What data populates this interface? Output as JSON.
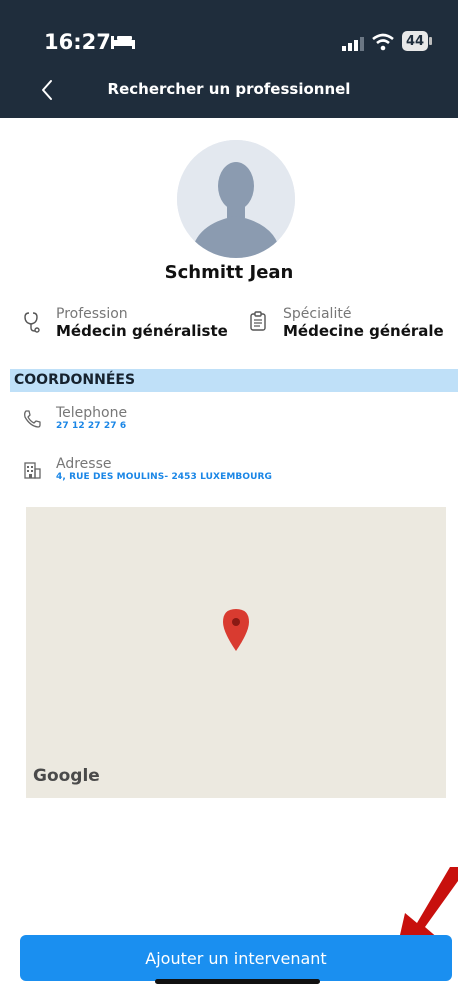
{
  "status_bar": {
    "time": "16:27",
    "battery_level": "44",
    "icons": [
      "bed-icon",
      "signal-icon",
      "wifi-icon",
      "battery-icon"
    ]
  },
  "header": {
    "title": "Rechercher un professionnel",
    "back_icon": "chevron-left-icon"
  },
  "profile": {
    "name": "Schmitt Jean",
    "profession_label": "Profession",
    "profession_value": "Médecin généraliste",
    "specialite_label": "Spécialité",
    "specialite_value": "Médecine générale"
  },
  "coordonnees": {
    "section_title": "COORDONNÉES",
    "telephone_label": "Telephone",
    "telephone_value": "27 12 27 27 6",
    "adresse_label": "Adresse",
    "adresse_value": "4, RUE DES MOULINS- 2453 LUXEMBOURG"
  },
  "map": {
    "attribution": "Google",
    "pin_color": "#d93b30"
  },
  "action": {
    "button_label": "Ajouter un intervenant"
  },
  "colors": {
    "header_bg": "#1f2d3c",
    "accent": "#1a8ff0",
    "section_bg": "#bfe0f8",
    "link": "#1a86e6"
  }
}
